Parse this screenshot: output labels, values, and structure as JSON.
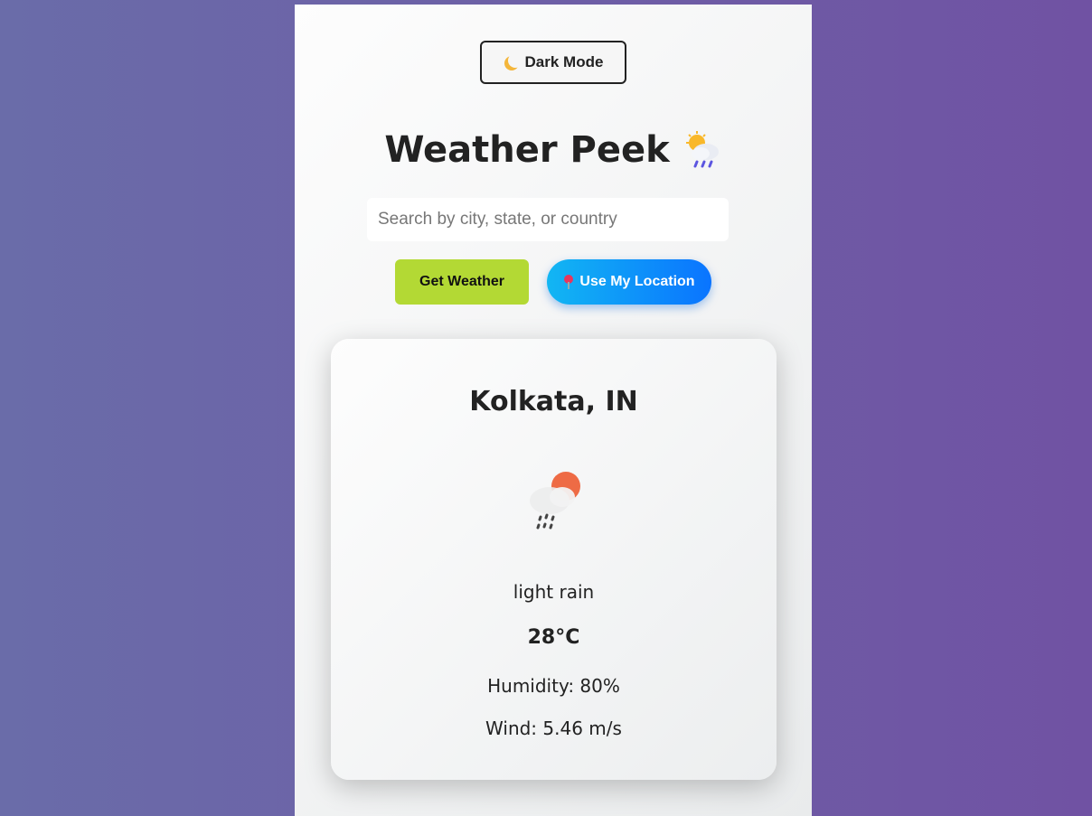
{
  "theme_toggle": {
    "label": "Dark Mode",
    "icon": "moon-icon"
  },
  "app": {
    "title": "Weather Peek",
    "title_icon": "sun-behind-rain-cloud-icon"
  },
  "search": {
    "placeholder": "Search by city, state, or country",
    "value": ""
  },
  "buttons": {
    "get_weather": "Get Weather",
    "use_location": "Use My Location",
    "use_location_icon": "pin-icon"
  },
  "weather": {
    "location": "Kolkata, IN",
    "icon": "rain-cloud-sun-icon",
    "description": "light rain",
    "temperature": "28°C",
    "humidity": "Humidity: 80%",
    "wind": "Wind: 5.46 m/s"
  },
  "colors": {
    "accent_green": "#b3d934",
    "accent_blue": "#0a74ff",
    "sun_orange": "#ee6b45"
  }
}
